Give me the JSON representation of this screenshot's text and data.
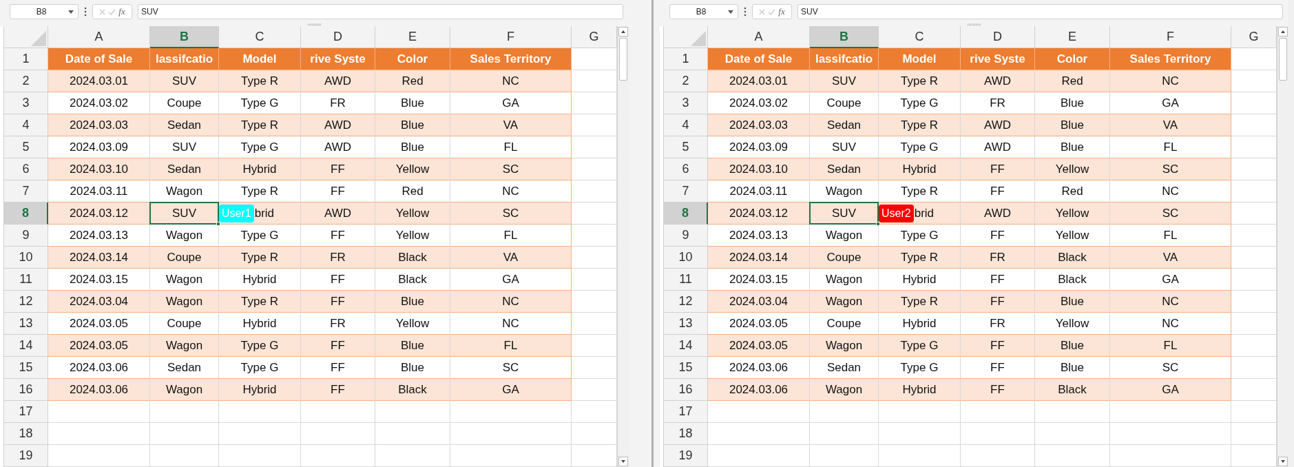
{
  "panes": [
    {
      "name_box": "B8",
      "function_label": "fx",
      "formula": "SUV",
      "cursor": {
        "label": "User1",
        "color": "#00ffff"
      },
      "column_headers": [
        {
          "label": "A",
          "selected": false
        },
        {
          "label": "B",
          "selected": true
        },
        {
          "label": "C",
          "selected": false
        },
        {
          "label": "D",
          "selected": false
        },
        {
          "label": "E",
          "selected": false
        },
        {
          "label": "F",
          "selected": false
        },
        {
          "label": "G",
          "selected": false
        }
      ],
      "rows": [
        {
          "number": "1",
          "selected": false,
          "kind": "header",
          "cells": [
            "Date of Sale",
            "lassifcatio",
            "Model",
            "rive Syste",
            "Color",
            "Sales Territory"
          ]
        },
        {
          "number": "2",
          "selected": false,
          "kind": "band",
          "cells": [
            "2024.03.01",
            "SUV",
            "Type R",
            "AWD",
            "Red",
            "NC"
          ]
        },
        {
          "number": "3",
          "selected": false,
          "kind": "plain",
          "cells": [
            "2024.03.02",
            "Coupe",
            "Type G",
            "FR",
            "Blue",
            "GA"
          ]
        },
        {
          "number": "4",
          "selected": false,
          "kind": "band",
          "cells": [
            "2024.03.03",
            "Sedan",
            "Type R",
            "AWD",
            "Blue",
            "VA"
          ]
        },
        {
          "number": "5",
          "selected": false,
          "kind": "plain",
          "cells": [
            "2024.03.09",
            "SUV",
            "Type G",
            "AWD",
            "Blue",
            "FL"
          ]
        },
        {
          "number": "6",
          "selected": false,
          "kind": "band",
          "cells": [
            "2024.03.10",
            "Sedan",
            "Hybrid",
            "FF",
            "Yellow",
            "SC"
          ]
        },
        {
          "number": "7",
          "selected": false,
          "kind": "plain",
          "cells": [
            "2024.03.11",
            "Wagon",
            "Type R",
            "FF",
            "Red",
            "NC"
          ]
        },
        {
          "number": "8",
          "selected": true,
          "kind": "band",
          "cells": [
            "2024.03.12",
            "SUV",
            "brid",
            "AWD",
            "Yellow",
            "SC"
          ]
        },
        {
          "number": "9",
          "selected": false,
          "kind": "plain",
          "cells": [
            "2024.03.13",
            "Wagon",
            "Type G",
            "FF",
            "Yellow",
            "FL"
          ]
        },
        {
          "number": "10",
          "selected": false,
          "kind": "band",
          "cells": [
            "2024.03.14",
            "Coupe",
            "Type R",
            "FR",
            "Black",
            "VA"
          ]
        },
        {
          "number": "11",
          "selected": false,
          "kind": "plain",
          "cells": [
            "2024.03.15",
            "Wagon",
            "Hybrid",
            "FF",
            "Black",
            "GA"
          ]
        },
        {
          "number": "12",
          "selected": false,
          "kind": "band",
          "cells": [
            "2024.03.04",
            "Wagon",
            "Type R",
            "FF",
            "Blue",
            "NC"
          ]
        },
        {
          "number": "13",
          "selected": false,
          "kind": "plain",
          "cells": [
            "2024.03.05",
            "Coupe",
            "Hybrid",
            "FR",
            "Yellow",
            "NC"
          ]
        },
        {
          "number": "14",
          "selected": false,
          "kind": "band",
          "cells": [
            "2024.03.05",
            "Wagon",
            "Type G",
            "FF",
            "Blue",
            "FL"
          ]
        },
        {
          "number": "15",
          "selected": false,
          "kind": "plain",
          "cells": [
            "2024.03.06",
            "Sedan",
            "Type G",
            "FF",
            "Blue",
            "SC"
          ]
        },
        {
          "number": "16",
          "selected": false,
          "kind": "band",
          "cells": [
            "2024.03.06",
            "Wagon",
            "Hybrid",
            "FF",
            "Black",
            "GA"
          ]
        },
        {
          "number": "17",
          "selected": false,
          "kind": "empty"
        },
        {
          "number": "18",
          "selected": false,
          "kind": "empty"
        },
        {
          "number": "19",
          "selected": false,
          "kind": "empty"
        }
      ]
    },
    {
      "name_box": "B8",
      "function_label": "fx",
      "formula": "SUV",
      "cursor": {
        "label": "User2",
        "color": "#ff0000"
      },
      "column_headers": [
        {
          "label": "A",
          "selected": false
        },
        {
          "label": "B",
          "selected": true
        },
        {
          "label": "C",
          "selected": false
        },
        {
          "label": "D",
          "selected": false
        },
        {
          "label": "E",
          "selected": false
        },
        {
          "label": "F",
          "selected": false
        },
        {
          "label": "G",
          "selected": false
        }
      ],
      "rows": [
        {
          "number": "1",
          "selected": false,
          "kind": "header",
          "cells": [
            "Date of Sale",
            "lassifcatio",
            "Model",
            "rive Syste",
            "Color",
            "Sales Territory"
          ]
        },
        {
          "number": "2",
          "selected": false,
          "kind": "band",
          "cells": [
            "2024.03.01",
            "SUV",
            "Type R",
            "AWD",
            "Red",
            "NC"
          ]
        },
        {
          "number": "3",
          "selected": false,
          "kind": "plain",
          "cells": [
            "2024.03.02",
            "Coupe",
            "Type G",
            "FR",
            "Blue",
            "GA"
          ]
        },
        {
          "number": "4",
          "selected": false,
          "kind": "band",
          "cells": [
            "2024.03.03",
            "Sedan",
            "Type R",
            "AWD",
            "Blue",
            "VA"
          ]
        },
        {
          "number": "5",
          "selected": false,
          "kind": "plain",
          "cells": [
            "2024.03.09",
            "SUV",
            "Type G",
            "AWD",
            "Blue",
            "FL"
          ]
        },
        {
          "number": "6",
          "selected": false,
          "kind": "band",
          "cells": [
            "2024.03.10",
            "Sedan",
            "Hybrid",
            "FF",
            "Yellow",
            "SC"
          ]
        },
        {
          "number": "7",
          "selected": false,
          "kind": "plain",
          "cells": [
            "2024.03.11",
            "Wagon",
            "Type R",
            "FF",
            "Red",
            "NC"
          ]
        },
        {
          "number": "8",
          "selected": true,
          "kind": "band",
          "cells": [
            "2024.03.12",
            "SUV",
            "brid",
            "AWD",
            "Yellow",
            "SC"
          ]
        },
        {
          "number": "9",
          "selected": false,
          "kind": "plain",
          "cells": [
            "2024.03.13",
            "Wagon",
            "Type G",
            "FF",
            "Yellow",
            "FL"
          ]
        },
        {
          "number": "10",
          "selected": false,
          "kind": "band",
          "cells": [
            "2024.03.14",
            "Coupe",
            "Type R",
            "FR",
            "Black",
            "VA"
          ]
        },
        {
          "number": "11",
          "selected": false,
          "kind": "plain",
          "cells": [
            "2024.03.15",
            "Wagon",
            "Hybrid",
            "FF",
            "Black",
            "GA"
          ]
        },
        {
          "number": "12",
          "selected": false,
          "kind": "band",
          "cells": [
            "2024.03.04",
            "Wagon",
            "Type R",
            "FF",
            "Blue",
            "NC"
          ]
        },
        {
          "number": "13",
          "selected": false,
          "kind": "plain",
          "cells": [
            "2024.03.05",
            "Coupe",
            "Hybrid",
            "FR",
            "Yellow",
            "NC"
          ]
        },
        {
          "number": "14",
          "selected": false,
          "kind": "band",
          "cells": [
            "2024.03.05",
            "Wagon",
            "Type G",
            "FF",
            "Blue",
            "FL"
          ]
        },
        {
          "number": "15",
          "selected": false,
          "kind": "plain",
          "cells": [
            "2024.03.06",
            "Sedan",
            "Type G",
            "FF",
            "Blue",
            "SC"
          ]
        },
        {
          "number": "16",
          "selected": false,
          "kind": "band",
          "cells": [
            "2024.03.06",
            "Wagon",
            "Hybrid",
            "FF",
            "Black",
            "GA"
          ]
        },
        {
          "number": "17",
          "selected": false,
          "kind": "empty"
        },
        {
          "number": "18",
          "selected": false,
          "kind": "empty"
        },
        {
          "number": "19",
          "selected": false,
          "kind": "empty"
        }
      ]
    }
  ]
}
